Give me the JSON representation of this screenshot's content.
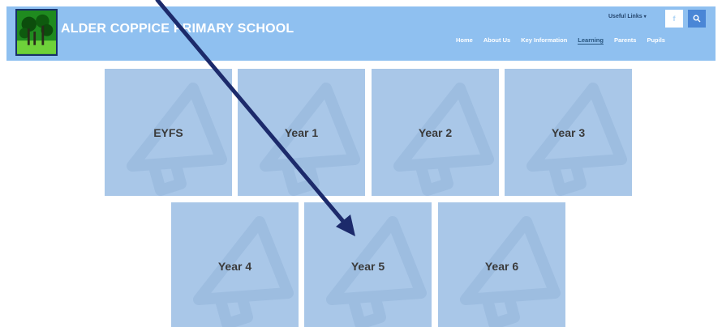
{
  "header": {
    "school_name": "ALDER COPPICE PRIMARY SCHOOL",
    "useful_links": "Useful Links",
    "facebook_glyph": "f",
    "nav": [
      "Home",
      "About Us",
      "Key Information",
      "Learning",
      "Parents",
      "Pupils"
    ],
    "active_nav": "Learning"
  },
  "tiles": [
    "EYFS",
    "Year 1",
    "Year 2",
    "Year 3",
    "Year 4",
    "Year 5",
    "Year 6"
  ],
  "colors": {
    "header_bg": "#8fc0f0",
    "tile_bg": "#a9c7e8",
    "annotation_arrow": "#1c2a6b",
    "search_button": "#4a86d6"
  },
  "icons": {
    "tile_background": "megaphone-icon",
    "search": "search-icon",
    "facebook": "facebook-icon",
    "dropdown": "chevron-down-icon"
  }
}
